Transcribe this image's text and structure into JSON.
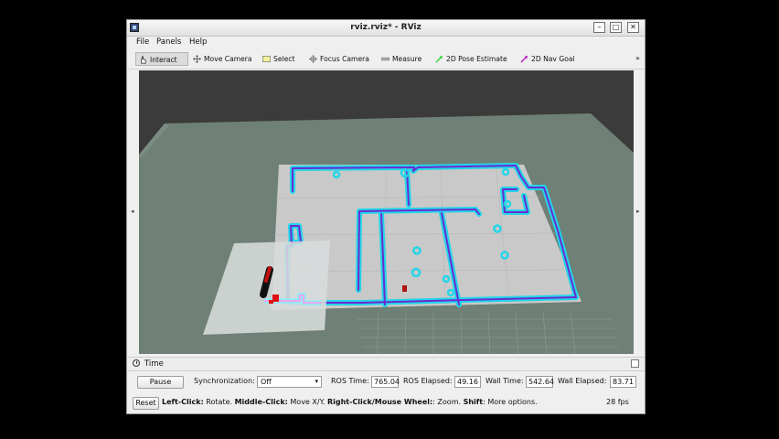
{
  "window": {
    "title": "rviz.rviz* - RViz",
    "minimize": "–",
    "maximize": "□",
    "close": "✕"
  },
  "menu": {
    "file": "File",
    "panels": "Panels",
    "help": "Help"
  },
  "toolbar": {
    "interact": "Interact",
    "move_camera": "Move Camera",
    "select": "Select",
    "focus_camera": "Focus Camera",
    "measure": "Measure",
    "pose_estimate": "2D Pose Estimate",
    "nav_goal": "2D Nav Goal",
    "more": "»"
  },
  "time_panel": {
    "title": "Time",
    "pause": "Pause",
    "sync_label": "Synchronization:",
    "sync_value": "Off",
    "ros_time_label": "ROS Time:",
    "ros_time": "765.04",
    "ros_elapsed_label": "ROS Elapsed:",
    "ros_elapsed": "49.16",
    "wall_time_label": "Wall Time:",
    "wall_time": "542.64",
    "wall_elapsed_label": "Wall Elapsed:",
    "wall_elapsed": "83.71"
  },
  "status": {
    "reset": "Reset",
    "left_click": "Left-Click:",
    "left_click_desc": " Rotate. ",
    "middle_click": "Middle-Click:",
    "middle_click_desc": " Move X/Y. ",
    "right_click": "Right-Click/Mouse Wheel:",
    "right_click_desc": ": Zoom. ",
    "shift": "Shift",
    "shift_desc": ": More options.",
    "fps": "28 fps"
  },
  "colors": {
    "background": "#3b3b3b",
    "ground": "#6f8076",
    "wall_inner": "#6a2bd1",
    "wall_outer": "#22d6e8",
    "robot": "#e01010"
  }
}
